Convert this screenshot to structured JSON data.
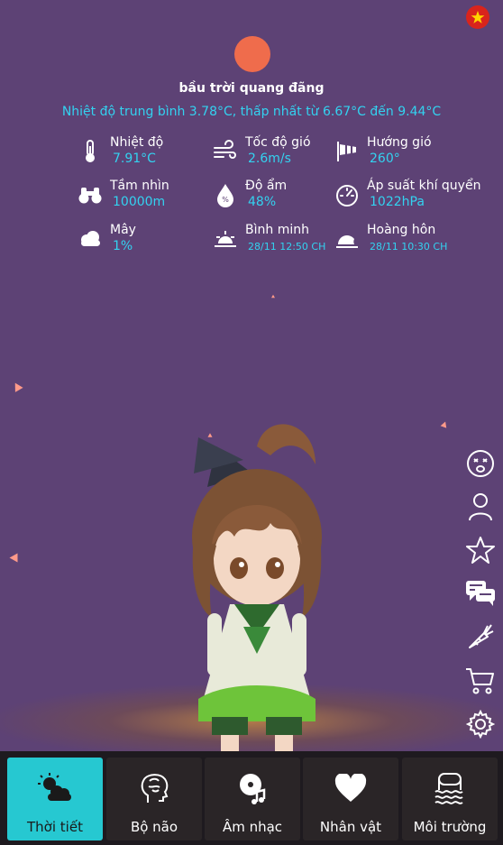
{
  "weather": {
    "condition": "bầu trời quang đãng",
    "average": "Nhiệt độ trung bình 3.78°C, thấp nhất từ 6.67°C đến 9.44°C",
    "sun_color": "#ef6c4c",
    "stats": [
      {
        "label": "Nhiệt độ",
        "value": "7.91°C",
        "icon": "thermometer-icon"
      },
      {
        "label": "Tốc độ gió",
        "value": "2.6m/s",
        "icon": "wind-icon"
      },
      {
        "label": "Hướng gió",
        "value": "260°",
        "icon": "windsock-icon"
      },
      {
        "label": "Tầm nhìn",
        "value": "10000m",
        "icon": "binoculars-icon"
      },
      {
        "label": "Độ ẩm",
        "value": "48%",
        "icon": "humidity-drop-icon"
      },
      {
        "label": "Áp suất khí quyển",
        "value": "1022hPa",
        "icon": "gauge-icon"
      },
      {
        "label": "Mây",
        "value": "1%",
        "icon": "cloud-icon"
      },
      {
        "label": "Bình minh",
        "value": "28/11 12:50 CH",
        "icon": "sunrise-icon"
      },
      {
        "label": "Hoàng hôn",
        "value": "28/11 10:30 CH",
        "icon": "sunset-icon"
      }
    ]
  },
  "side_menu": [
    {
      "icon": "tired-face-icon"
    },
    {
      "icon": "person-icon"
    },
    {
      "icon": "star-icon"
    },
    {
      "icon": "chat-icon"
    },
    {
      "icon": "carrot-icon"
    },
    {
      "icon": "cart-icon"
    },
    {
      "icon": "gear-icon"
    }
  ],
  "tabs": [
    {
      "label": "Thời tiết",
      "icon": "weather-icon",
      "active": true
    },
    {
      "label": "Bộ não",
      "icon": "brain-icon",
      "active": false
    },
    {
      "label": "Âm nhạc",
      "icon": "music-disc-icon",
      "active": false
    },
    {
      "label": "Nhân vật",
      "icon": "heart-icon",
      "active": false
    },
    {
      "label": "Môi trường",
      "icon": "environment-icon",
      "active": false
    }
  ],
  "colors": {
    "background": "#5d4275",
    "accent": "#33d2f0",
    "active_tab": "#26c8d1",
    "tab_bar": "#1e1a1f"
  }
}
